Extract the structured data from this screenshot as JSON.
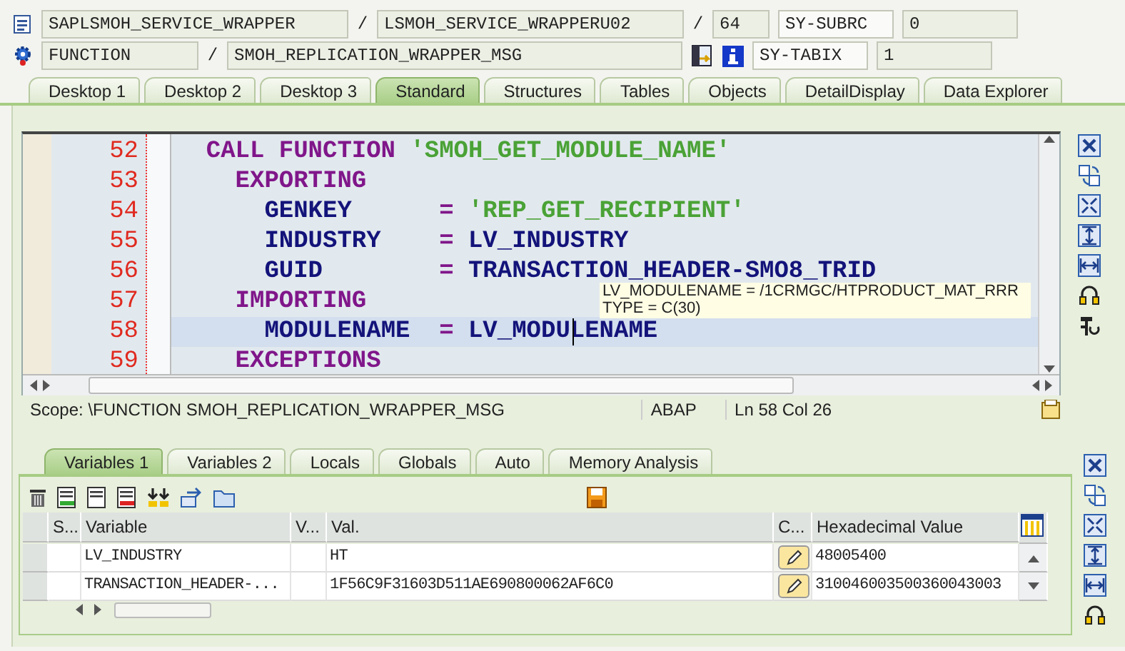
{
  "header": {
    "rows": [
      {
        "items": [
          {
            "kind": "doc-icon"
          },
          {
            "kind": "field",
            "text": "SAPLSMOH_SERVICE_WRAPPER"
          },
          {
            "kind": "sep",
            "text": "/"
          },
          {
            "kind": "field",
            "text": "LSMOH_SERVICE_WRAPPERU02"
          },
          {
            "kind": "sep",
            "text": "/"
          },
          {
            "kind": "field",
            "text": "64"
          },
          {
            "kind": "name-field",
            "text": "SY-SUBRC"
          },
          {
            "kind": "field",
            "text": "0"
          }
        ]
      },
      {
        "items": [
          {
            "kind": "gear-icon"
          },
          {
            "kind": "field",
            "text": "FUNCTION"
          },
          {
            "kind": "sep",
            "text": "/"
          },
          {
            "kind": "field",
            "text": "SMOH_REPLICATION_WRAPPER_MSG"
          },
          {
            "kind": "exec-icon"
          },
          {
            "kind": "info-icon"
          },
          {
            "kind": "name-field",
            "text": "SY-TABIX"
          },
          {
            "kind": "field",
            "text": "1"
          }
        ]
      }
    ]
  },
  "desktop_tabs": [
    {
      "label": "Desktop 1",
      "selected": false
    },
    {
      "label": "Desktop 2",
      "selected": false
    },
    {
      "label": "Desktop 3",
      "selected": false
    },
    {
      "label": "Standard",
      "selected": true
    },
    {
      "label": "Structures",
      "selected": false
    },
    {
      "label": "Tables",
      "selected": false
    },
    {
      "label": "Objects",
      "selected": false
    },
    {
      "label": "DetailDisplay",
      "selected": false
    },
    {
      "label": "Data Explorer",
      "selected": false
    }
  ],
  "editor": {
    "lines": [
      {
        "number": "52",
        "kind": "statement",
        "current": false,
        "tokens": [
          {
            "text": "CALL FUNCTION",
            "kind": "keyword"
          },
          {
            "text": "'SMOH_GET_MODULE_NAME'",
            "kind": "string"
          }
        ]
      },
      {
        "number": "53",
        "kind": "section",
        "current": false,
        "tokens": [
          {
            "text": "EXPORTING",
            "kind": "keyword"
          }
        ]
      },
      {
        "number": "54",
        "kind": "parameter",
        "current": false,
        "tokens": [
          {
            "text": "GENKEY",
            "kind": "name"
          },
          {
            "text": "=",
            "kind": "operator"
          },
          {
            "text": "'REP_GET_RECIPIENT'",
            "kind": "string"
          }
        ]
      },
      {
        "number": "55",
        "kind": "parameter",
        "current": false,
        "tokens": [
          {
            "text": "INDUSTRY",
            "kind": "name"
          },
          {
            "text": "=",
            "kind": "operator"
          },
          {
            "text": "LV_INDUSTRY",
            "kind": "name"
          }
        ]
      },
      {
        "number": "56",
        "kind": "parameter",
        "current": false,
        "tokens": [
          {
            "text": "GUID",
            "kind": "name"
          },
          {
            "text": "=",
            "kind": "operator"
          },
          {
            "text": "TRANSACTION_HEADER-SMO8_TRID",
            "kind": "name"
          }
        ]
      },
      {
        "number": "57",
        "kind": "section",
        "current": false,
        "tokens": [
          {
            "text": "IMPORTING",
            "kind": "keyword"
          }
        ]
      },
      {
        "number": "58",
        "kind": "parameter",
        "current": true,
        "tokens": [
          {
            "text": "MODULENAME",
            "kind": "name"
          },
          {
            "text": "=",
            "kind": "operator"
          },
          {
            "text": "LV_MODULENAME",
            "kind": "name"
          }
        ]
      },
      {
        "number": "59",
        "kind": "section",
        "current": false,
        "tokens": [
          {
            "text": "EXCEPTIONS",
            "kind": "keyword"
          }
        ]
      }
    ],
    "tooltip": [
      "LV_MODULENAME = /1CRMGC/HTPRODUCT_MAT_RRR",
      "TYPE  = C(30)"
    ]
  },
  "status_bar": {
    "scope": "Scope: \\FUNCTION SMOH_REPLICATION_WRAPPER_MSG",
    "language": "ABAP",
    "position": "Ln  58 Col  26"
  },
  "variable_tabs": [
    {
      "label": "Variables 1",
      "selected": true
    },
    {
      "label": "Variables 2",
      "selected": false
    },
    {
      "label": "Locals",
      "selected": false
    },
    {
      "label": "Globals",
      "selected": false
    },
    {
      "label": "Auto",
      "selected": false
    },
    {
      "label": "Memory Analysis",
      "selected": false
    }
  ],
  "variables_table": {
    "columns": [
      "S...",
      "Variable",
      "V...",
      "Val.",
      "C...",
      "Hexadecimal Value"
    ],
    "rows": [
      {
        "variable": "LV_INDUSTRY",
        "value": "HT",
        "hex": "48005400"
      },
      {
        "variable": "TRANSACTION_HEADER-...",
        "value": "1F56C9F31603D511AE690800062AF6C0",
        "hex": "310046003500360043003"
      }
    ]
  }
}
